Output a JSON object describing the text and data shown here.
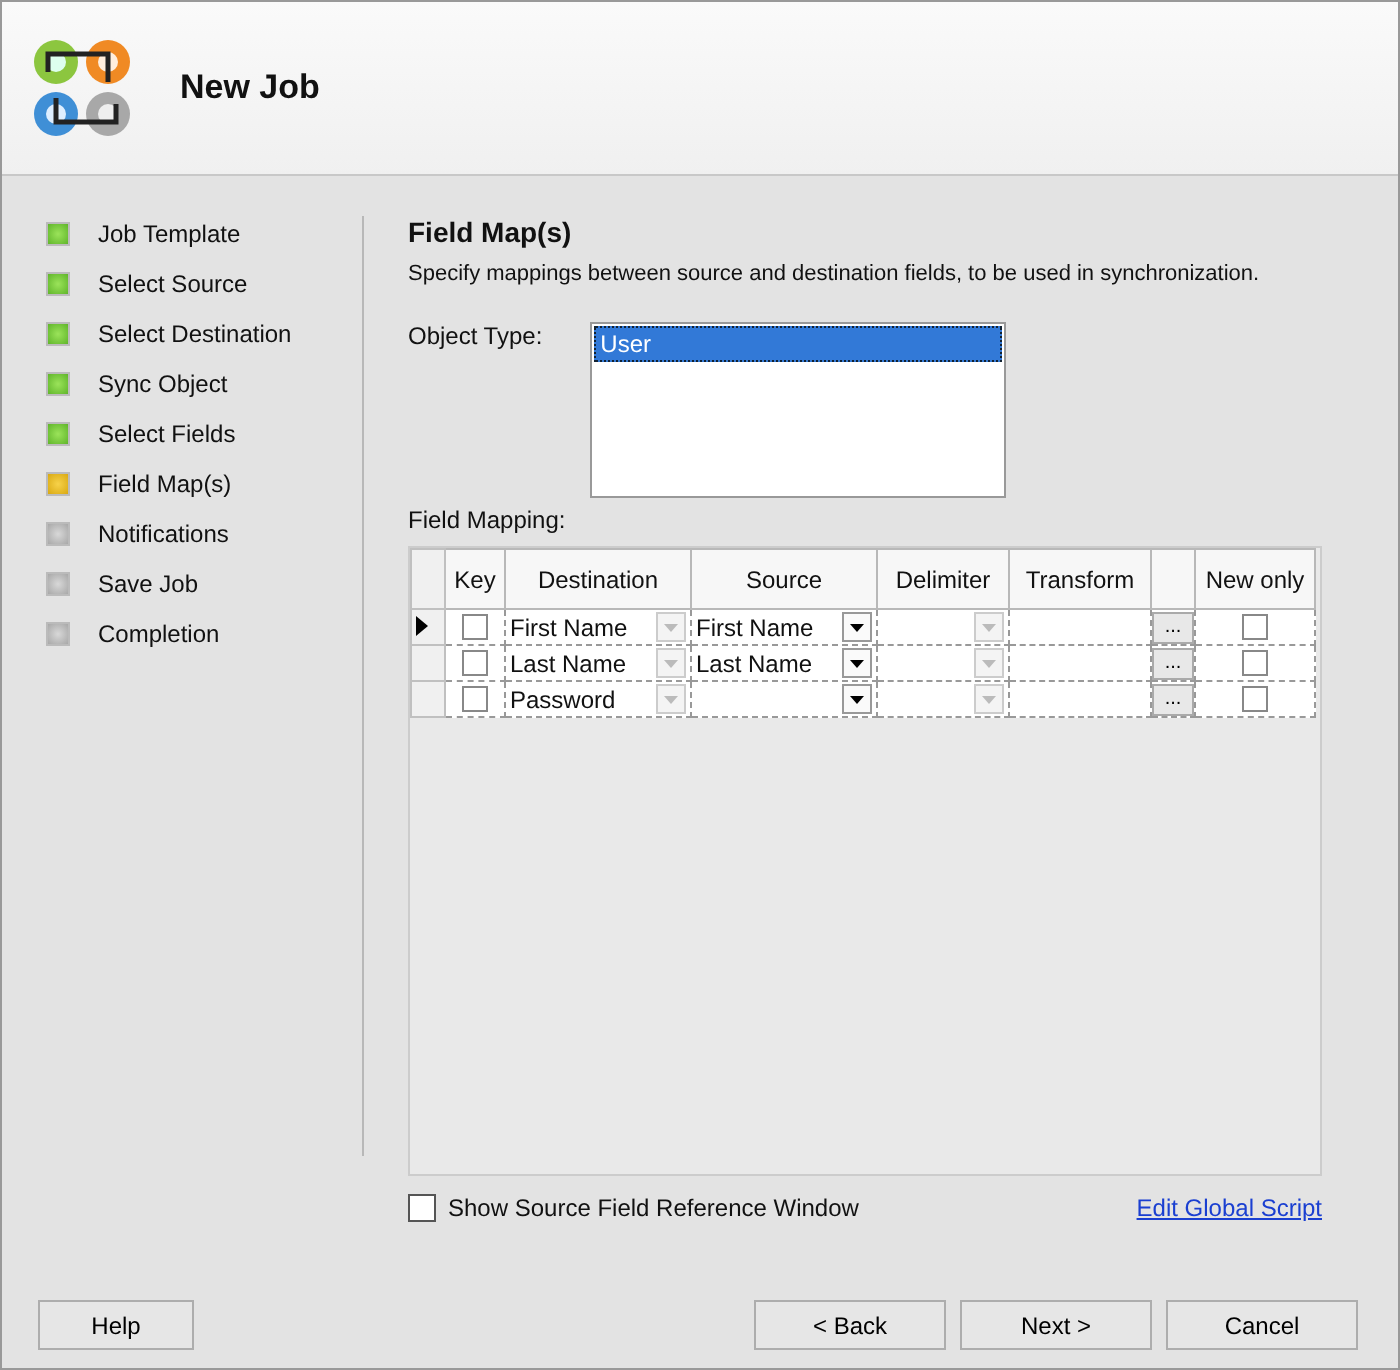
{
  "window": {
    "title": "New Job"
  },
  "steps": [
    {
      "label": "Job Template",
      "completed": true,
      "selected": false
    },
    {
      "label": "Select Source",
      "completed": true,
      "selected": false
    },
    {
      "label": "Select Destination",
      "completed": true,
      "selected": false
    },
    {
      "label": "Sync Object",
      "completed": true,
      "selected": false
    },
    {
      "label": "Select Fields",
      "completed": true,
      "selected": false
    },
    {
      "label": "Field Map(s)",
      "completed": false,
      "selected": true
    },
    {
      "label": "Notifications",
      "completed": false,
      "selected": false
    },
    {
      "label": "Save Job",
      "completed": false,
      "selected": false
    },
    {
      "label": "Completion",
      "completed": false,
      "selected": false
    }
  ],
  "section": {
    "title": "Field Map(s)",
    "description": "Specify mappings between source and destination fields, to be used in synchronization."
  },
  "object_type": {
    "label": "Object Type:",
    "items": [
      {
        "text": "User",
        "selected": true
      }
    ]
  },
  "field_mapping": {
    "label": "Field Mapping:",
    "columns": [
      {
        "kind": "key",
        "label": "Key"
      },
      {
        "kind": "destination",
        "label": "Destination"
      },
      {
        "kind": "source",
        "label": "Source"
      },
      {
        "kind": "delimiter",
        "label": "Delimiter"
      },
      {
        "kind": "transform",
        "label": "Transform"
      },
      {
        "kind": "script"
      },
      {
        "kind": "new_only",
        "label": "New only"
      }
    ],
    "rows": [
      {
        "current": true,
        "key": false,
        "destination": "First Name",
        "source": "First Name",
        "script": "...",
        "new_only": false
      },
      {
        "current": false,
        "key": false,
        "destination": "Last Name",
        "source": "Last Name",
        "script": "...",
        "new_only": false
      },
      {
        "current": false,
        "key": false,
        "destination": "Password",
        "script": "...",
        "new_only": false
      }
    ]
  },
  "show_reference": {
    "label": "Show Source Field Reference Window",
    "checked": false
  },
  "global_script_link": "Edit Global Script",
  "help_button": "Help",
  "nav_buttons": [
    "< Back",
    "Next >",
    "Cancel"
  ]
}
